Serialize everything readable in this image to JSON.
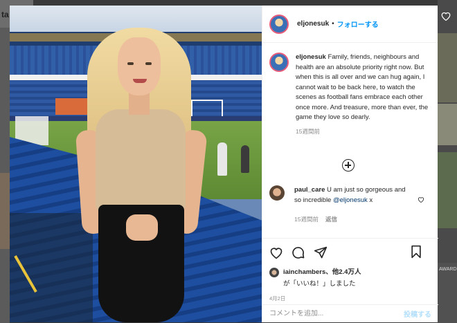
{
  "background": {
    "left_logo_text": "ta",
    "right_thumb_text": "AWARD"
  },
  "post": {
    "author": "eljonesuk",
    "follow_label": "フォローする",
    "caption_author": "eljonesuk",
    "caption": "Family, friends, neighbours and health are an absolute priority right now. But when this is all over and we can hug again, I cannot wait to be back here, to watch the scenes as football fans embrace each other once more. And treasure, more than ever, the game they love so dearly.",
    "caption_time": "15週間前",
    "comments": [
      {
        "author": "paul_care",
        "text": "U am just so gorgeous and so incredible ",
        "mention": "@eljonesuk",
        "suffix": " x",
        "time": "15週間前",
        "reply_label": "返信"
      }
    ],
    "likes": {
      "user": "iainchambers",
      "others": "、他2.4万人",
      "line2": "が「いいね！」しました"
    },
    "date": "4月2日",
    "add_comment_placeholder": "コメントを追加...",
    "post_button": "投稿する"
  },
  "colors": {
    "link_blue": "#0095f6",
    "text": "#262626",
    "muted": "#8e8e8e"
  }
}
